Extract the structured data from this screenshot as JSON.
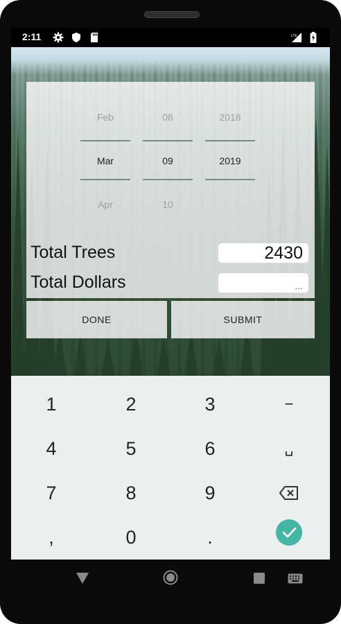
{
  "status_bar": {
    "time": "2:11"
  },
  "date_picker": {
    "month": {
      "prev": "Feb",
      "selected": "Mar",
      "next": "Apr"
    },
    "day": {
      "prev": "08",
      "selected": "09",
      "next": "10"
    },
    "year": {
      "prev": "2018",
      "selected": "2019",
      "next": ""
    }
  },
  "form": {
    "total_trees_label": "Total Trees",
    "total_trees_value": "2430",
    "total_dollars_label": "Total Dollars",
    "total_dollars_value": "..."
  },
  "buttons": {
    "done": "DONE",
    "submit": "SUBMIT"
  },
  "keypad": {
    "row1": [
      "1",
      "2",
      "3",
      "−"
    ],
    "row2": [
      "4",
      "5",
      "6",
      "␣"
    ],
    "row3": [
      "7",
      "8",
      "9"
    ],
    "row4": [
      ",",
      "0",
      "."
    ]
  },
  "colors": {
    "accent": "#45b5a5",
    "keyboard_bg": "#eceff0"
  }
}
